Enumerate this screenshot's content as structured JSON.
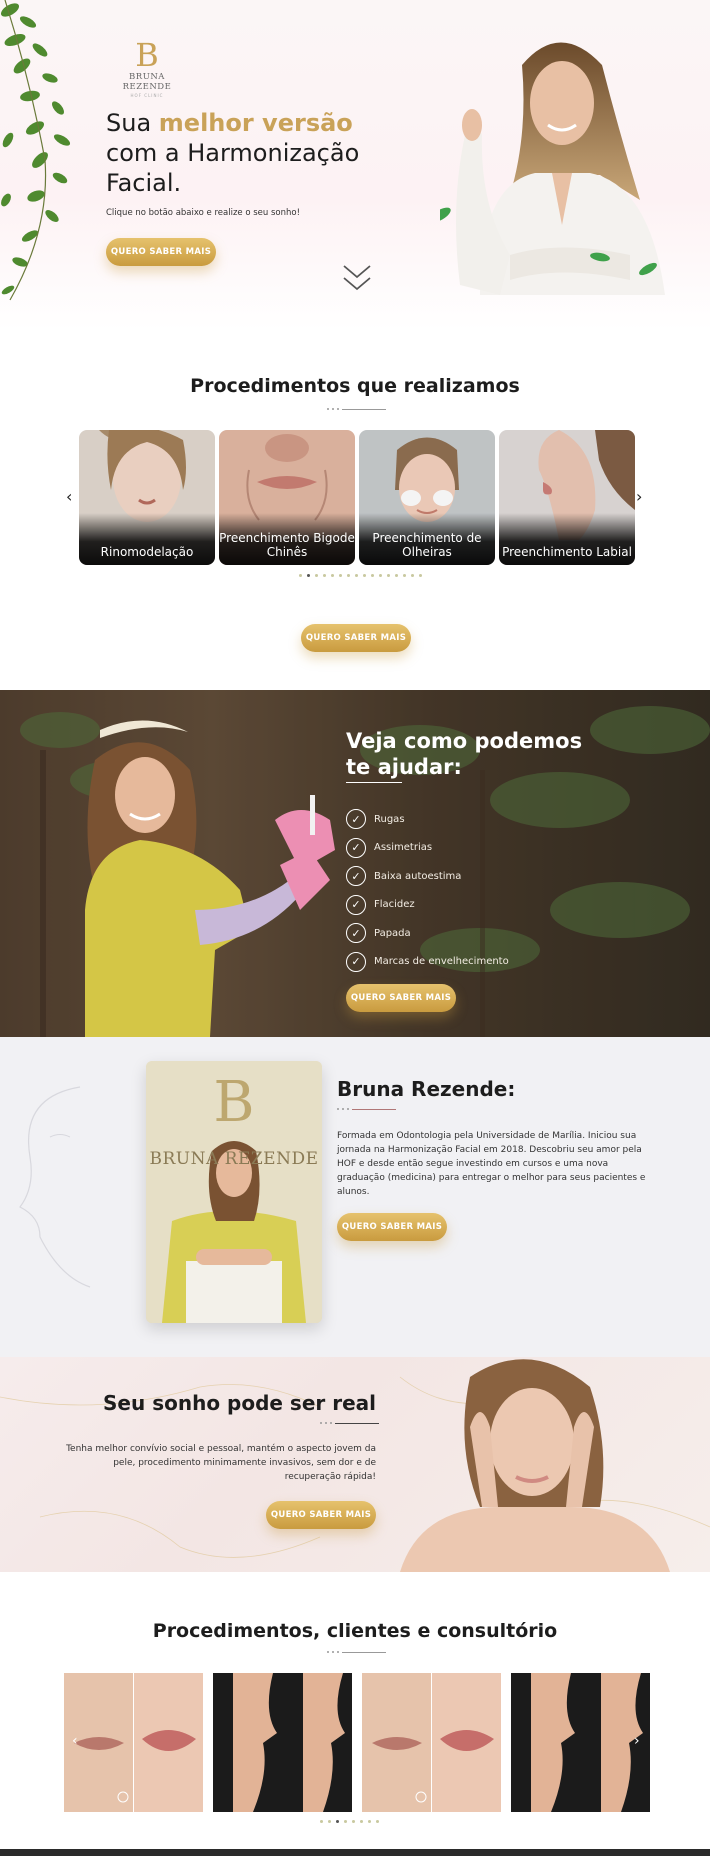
{
  "hero": {
    "logo_name": "BRUNA REZENDE",
    "logo_monogram": "B",
    "logo_sub": "HOF CLINIC",
    "title_pre": "Sua ",
    "title_highlight": "melhor versão",
    "title_post": " com a Harmonização Facial.",
    "subtitle": "Clique no botão abaixo e realize o seu sonho!",
    "cta": "QUERO SABER MAIS",
    "scroll_icon": "double-chevron-down-icon"
  },
  "procedures": {
    "title": "Procedimentos que realizamos",
    "cards": [
      {
        "label": "Rinomodelação"
      },
      {
        "label": "Preenchimento Bigode Chinês"
      },
      {
        "label": "Preenchimento de Olheiras"
      },
      {
        "label": "Preenchimento Labial"
      }
    ],
    "dot_count": 16,
    "active_dot": 1,
    "cta": "QUERO SABER MAIS"
  },
  "help": {
    "title": "Veja como podemos te ajudar:",
    "items": [
      "Rugas",
      "Assimetrias",
      "Baixa autoestima",
      "Flacidez",
      "Papada",
      "Marcas de envelhecimento"
    ],
    "cta": "QUERO SABER MAIS"
  },
  "about": {
    "name": "Bruna Rezende:",
    "photo_logo": "BRUNA REZENDE",
    "bio": "Formada em Odontologia pela Universidade de Marília. Iniciou sua jornada na Harmonização Facial em 2018. Descobriu seu amor pela HOF e desde então segue investindo em cursos e uma nova graduação (medicina) para entregar o melhor para seus pacientes e alunos.",
    "cta": "QUERO SABER MAIS"
  },
  "dream": {
    "title": "Seu sonho pode ser real",
    "text": "Tenha melhor convívio social e pessoal, mantém o aspecto jovem da pele, procedimento minimamente invasivos, sem dor e de recuperação rápida!",
    "cta": "QUERO SABER MAIS"
  },
  "gallery": {
    "title": "Procedimentos, clientes e consultório",
    "dot_count": 8,
    "active_dot": 2
  },
  "colors": {
    "gold": "#c9a258",
    "button_top": "#e6c26d",
    "button_bottom": "#c99b3f"
  }
}
